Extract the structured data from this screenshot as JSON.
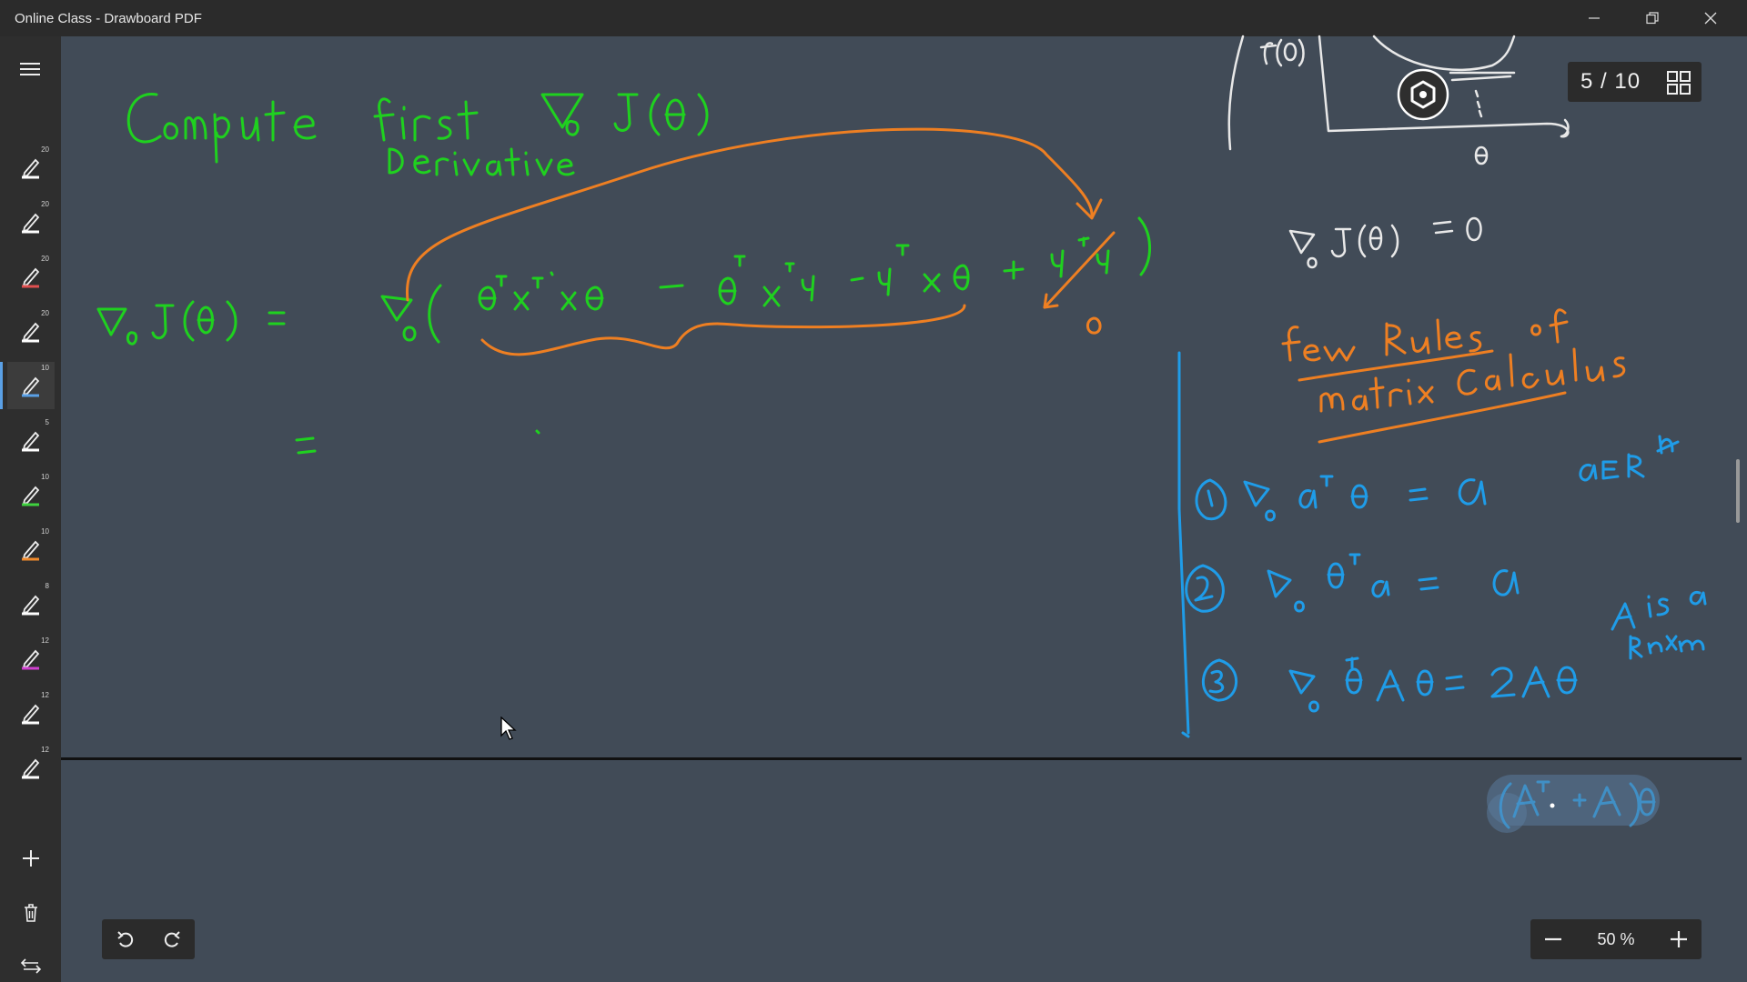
{
  "window": {
    "title": "Online Class - Drawboard PDF"
  },
  "pens": [
    {
      "size": "20",
      "color": "#ffffff"
    },
    {
      "size": "20",
      "color": "#ffffff"
    },
    {
      "size": "20",
      "color": "#e05050"
    },
    {
      "size": "20",
      "color": "#ffffff"
    },
    {
      "size": "10",
      "color": "#5aa0e6"
    },
    {
      "size": "5",
      "color": "#ffffff"
    },
    {
      "size": "10",
      "color": "#3fd13f"
    },
    {
      "size": "10",
      "color": "#f08a2c"
    },
    {
      "size": "8",
      "color": "#ffffff"
    },
    {
      "size": "12",
      "color": "#d040d0"
    },
    {
      "size": "12",
      "color": "#ffffff"
    },
    {
      "size": "12",
      "color": "#ffffff"
    }
  ],
  "page_counter": {
    "text": "5 / 10"
  },
  "zoom": {
    "value": "50 %"
  },
  "ink_colors": {
    "green": "#1fd11f",
    "orange": "#ee7f22",
    "blue": "#1f9ce8",
    "white": "#e8e8e8"
  }
}
